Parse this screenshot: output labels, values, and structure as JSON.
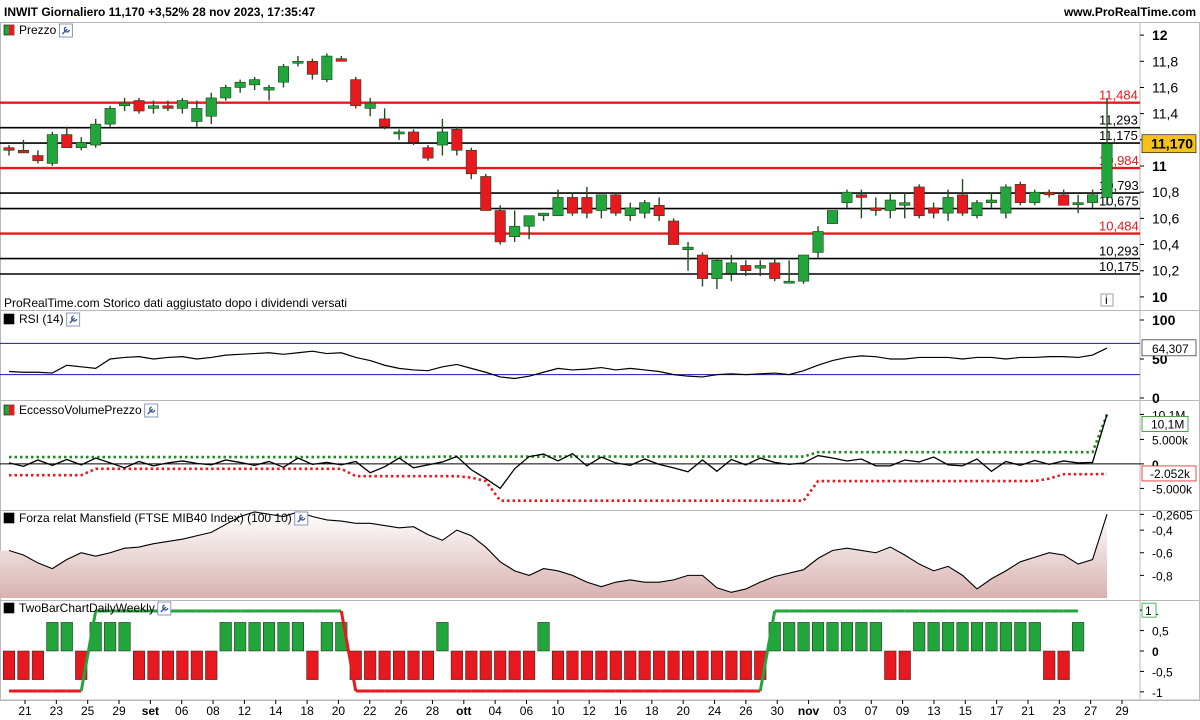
{
  "header": {
    "title": "INWIT Giornaliero 11,170 +3,52% 28 nov 2023, 17:35:47",
    "site": "www.ProRealTime.com"
  },
  "colors": {
    "up": "#22a63c",
    "down": "#e8191e",
    "wick": "#1f4f1f",
    "support_resistance": "#e8191e",
    "level": "#000000",
    "last_price_bg": "#f3c21b",
    "rsi": "#000000",
    "rsi_bands": "#1a1aa6",
    "evp_up_band": "#1e8c1e",
    "evp_down_band": "#e8191e",
    "mansfield_fill": "#d9b1b1",
    "twobar_up": "#22a63c",
    "twobar_down": "#e8191e"
  },
  "panels": {
    "price": {
      "title": "Prezzo",
      "icon": "wrench-icon",
      "note": "ProRealTime.com Storico dati aggiustato dopo i dividendi versati",
      "info_icon": "i"
    },
    "rsi": {
      "title": "RSI (14)",
      "icon": "wrench-icon"
    },
    "evp": {
      "title": "EccessoVolumePrezzo",
      "icon": "wrench-icon"
    },
    "mansfield": {
      "title": "Forza relat Mansfield (FTSE MIB40 Index) (100 10)",
      "icon": "wrench-icon"
    },
    "twobar": {
      "title": "TwoBarChartDailyWeekly",
      "icon": "wrench-icon"
    }
  },
  "chart_data": [
    {
      "type": "candlestick",
      "name": "Prezzo",
      "ylim": [
        9.9,
        12.1
      ],
      "y_ticks": [
        "12",
        "11,8",
        "11,6",
        "11,4",
        "11,2",
        "11",
        "10,8",
        "10,6",
        "10,4",
        "10,2",
        "10"
      ],
      "y_tick_values": [
        12,
        11.8,
        11.6,
        11.4,
        11.2,
        11,
        10.8,
        10.6,
        10.4,
        10.2,
        10
      ],
      "x_labels": [
        "21",
        "23",
        "25",
        "29",
        "set",
        "06",
        "08",
        "12",
        "14",
        "18",
        "20",
        "22",
        "26",
        "28",
        "ott",
        "04",
        "06",
        "10",
        "12",
        "16",
        "18",
        "20",
        "24",
        "26",
        "30",
        "nov",
        "03",
        "07",
        "09",
        "13",
        "15",
        "17",
        "21",
        "23",
        "27",
        "29"
      ],
      "x_label_months": [
        "set",
        "ott",
        "nov"
      ],
      "last_price": "11,170",
      "levels": [
        {
          "value": 11.484,
          "label": "11,484",
          "kind": "support_resistance"
        },
        {
          "value": 11.293,
          "label": "11,293",
          "kind": "level"
        },
        {
          "value": 11.175,
          "label": "11,175",
          "kind": "level"
        },
        {
          "value": 10.984,
          "label": "10,984",
          "kind": "support_resistance"
        },
        {
          "value": 10.793,
          "label": "10,793",
          "kind": "level"
        },
        {
          "value": 10.675,
          "label": "10,675",
          "kind": "level"
        },
        {
          "value": 10.484,
          "label": "10,484",
          "kind": "support_resistance"
        },
        {
          "value": 10.293,
          "label": "10,293",
          "kind": "level"
        },
        {
          "value": 10.175,
          "label": "10,175",
          "kind": "level"
        }
      ],
      "candles": [
        [
          11.14,
          11.16,
          11.08,
          11.12
        ],
        [
          11.12,
          11.2,
          11.1,
          11.1
        ],
        [
          11.08,
          11.12,
          11.02,
          11.04
        ],
        [
          11.02,
          11.26,
          11.0,
          11.24
        ],
        [
          11.24,
          11.3,
          11.16,
          11.14
        ],
        [
          11.14,
          11.22,
          11.12,
          11.18
        ],
        [
          11.16,
          11.36,
          11.14,
          11.32
        ],
        [
          11.32,
          11.46,
          11.3,
          11.44
        ],
        [
          11.46,
          11.52,
          11.42,
          11.48
        ],
        [
          11.5,
          11.52,
          11.4,
          11.42
        ],
        [
          11.44,
          11.5,
          11.4,
          11.46
        ],
        [
          11.46,
          11.5,
          11.42,
          11.44
        ],
        [
          11.44,
          11.52,
          11.4,
          11.5
        ],
        [
          11.34,
          11.5,
          11.3,
          11.44
        ],
        [
          11.38,
          11.56,
          11.32,
          11.52
        ],
        [
          11.52,
          11.62,
          11.5,
          11.6
        ],
        [
          11.6,
          11.66,
          11.56,
          11.64
        ],
        [
          11.62,
          11.68,
          11.58,
          11.66
        ],
        [
          11.58,
          11.62,
          11.5,
          11.6
        ],
        [
          11.64,
          11.78,
          11.6,
          11.76
        ],
        [
          11.8,
          11.84,
          11.76,
          11.8
        ],
        [
          11.8,
          11.82,
          11.66,
          11.7
        ],
        [
          11.66,
          11.86,
          11.64,
          11.84
        ],
        [
          11.82,
          11.84,
          11.8,
          11.8
        ],
        [
          11.66,
          11.68,
          11.44,
          11.46
        ],
        [
          11.44,
          11.52,
          11.38,
          11.48
        ],
        [
          11.36,
          11.44,
          11.28,
          11.3
        ],
        [
          11.26,
          11.28,
          11.2,
          11.26
        ],
        [
          11.26,
          11.28,
          11.16,
          11.18
        ],
        [
          11.14,
          11.16,
          11.04,
          11.06
        ],
        [
          11.16,
          11.36,
          11.08,
          11.26
        ],
        [
          11.28,
          11.3,
          11.08,
          11.12
        ],
        [
          11.12,
          11.14,
          10.9,
          10.94
        ],
        [
          10.92,
          10.94,
          10.66,
          10.66
        ],
        [
          10.66,
          10.7,
          10.4,
          10.42
        ],
        [
          10.46,
          10.66,
          10.42,
          10.54
        ],
        [
          10.54,
          10.56,
          10.44,
          10.62
        ],
        [
          10.62,
          10.64,
          10.58,
          10.64
        ],
        [
          10.62,
          10.82,
          10.62,
          10.76
        ],
        [
          10.76,
          10.8,
          10.62,
          10.64
        ],
        [
          10.76,
          10.84,
          10.6,
          10.64
        ],
        [
          10.66,
          10.74,
          10.6,
          10.78
        ],
        [
          10.78,
          10.8,
          10.62,
          10.64
        ],
        [
          10.62,
          10.72,
          10.58,
          10.68
        ],
        [
          10.64,
          10.74,
          10.6,
          10.72
        ],
        [
          10.7,
          10.76,
          10.58,
          10.62
        ],
        [
          10.58,
          10.6,
          10.4,
          10.4
        ],
        [
          10.36,
          10.42,
          10.2,
          10.38
        ],
        [
          10.32,
          10.34,
          10.08,
          10.14
        ],
        [
          10.14,
          10.3,
          10.06,
          10.28
        ],
        [
          10.18,
          10.32,
          10.12,
          10.26
        ],
        [
          10.24,
          10.28,
          10.16,
          10.2
        ],
        [
          10.22,
          10.28,
          10.16,
          10.24
        ],
        [
          10.26,
          10.3,
          10.12,
          10.14
        ],
        [
          10.12,
          10.28,
          10.12,
          10.12
        ],
        [
          10.12,
          10.3,
          10.1,
          10.32
        ],
        [
          10.34,
          10.54,
          10.3,
          10.5
        ],
        [
          10.56,
          10.64,
          10.6,
          10.66
        ],
        [
          10.72,
          10.82,
          10.68,
          10.8
        ],
        [
          10.78,
          10.82,
          10.6,
          10.76
        ],
        [
          10.68,
          10.76,
          10.62,
          10.66
        ],
        [
          10.66,
          10.8,
          10.6,
          10.74
        ],
        [
          10.7,
          10.8,
          10.6,
          10.72
        ],
        [
          10.84,
          10.86,
          10.6,
          10.62
        ],
        [
          10.68,
          10.72,
          10.6,
          10.64
        ],
        [
          10.64,
          10.82,
          10.58,
          10.76
        ],
        [
          10.78,
          10.9,
          10.62,
          10.64
        ],
        [
          10.62,
          10.74,
          10.6,
          10.72
        ],
        [
          10.72,
          10.8,
          10.68,
          10.74
        ],
        [
          10.64,
          10.86,
          10.6,
          10.84
        ],
        [
          10.86,
          10.88,
          10.7,
          10.72
        ],
        [
          10.72,
          10.82,
          10.7,
          10.8
        ],
        [
          10.8,
          10.82,
          10.76,
          10.78
        ],
        [
          10.78,
          10.82,
          10.74,
          10.7
        ],
        [
          10.72,
          10.78,
          10.64,
          10.72
        ],
        [
          10.72,
          10.82,
          10.68,
          10.78
        ],
        [
          10.76,
          11.52,
          10.7,
          11.17
        ]
      ],
      "candles_format": [
        "open",
        "high",
        "low",
        "close"
      ]
    },
    {
      "type": "line",
      "name": "RSI (14)",
      "ylim": [
        0,
        100
      ],
      "y_ticks": [
        "100",
        "50",
        "0"
      ],
      "y_tick_values": [
        100,
        50,
        0
      ],
      "bands": [
        70,
        30
      ],
      "last_value": "64,307",
      "values": [
        34,
        33,
        33,
        32,
        42,
        40,
        38,
        50,
        52,
        53,
        50,
        52,
        53,
        50,
        52,
        55,
        56,
        57,
        58,
        56,
        58,
        60,
        57,
        58,
        52,
        48,
        42,
        38,
        36,
        35,
        40,
        43,
        38,
        33,
        27,
        25,
        28,
        33,
        38,
        36,
        37,
        39,
        36,
        38,
        36,
        34,
        30,
        28,
        27,
        30,
        31,
        30,
        31,
        32,
        30,
        35,
        42,
        48,
        52,
        54,
        53,
        50,
        50,
        52,
        52,
        52,
        50,
        52,
        52,
        50,
        52,
        52,
        53,
        53,
        52,
        55,
        64
      ]
    },
    {
      "type": "line",
      "name": "EccessoVolumePrezzo",
      "ylim": [
        -9000,
        11000
      ],
      "y_ticks": [
        "10,1M",
        "5.000k",
        "0",
        "-5.000k"
      ],
      "y_tick_values": [
        10100,
        5000,
        0,
        -5000
      ],
      "last_values": [
        "10,1M",
        "-2.052k"
      ],
      "values": [
        200,
        -500,
        800,
        -300,
        900,
        -200,
        1200,
        200,
        -800,
        500,
        -400,
        200,
        600,
        100,
        -200,
        800,
        300,
        -300,
        500,
        -700,
        1200,
        -100,
        300,
        -200,
        500,
        -1800,
        -600,
        1200,
        -800,
        -200,
        400,
        1500,
        -1200,
        -3000,
        -5000,
        -1000,
        1500,
        2000,
        600,
        2100,
        -400,
        1400,
        200,
        -300,
        1000,
        -100,
        -800,
        -1600,
        800,
        -1500,
        900,
        -200,
        1200,
        300,
        -100,
        200,
        1700,
        1200,
        600,
        1000,
        -400,
        -400,
        800,
        400,
        1400,
        -200,
        -400,
        1000,
        -1500,
        500,
        -300,
        700,
        -100,
        600,
        200,
        300,
        10100
      ],
      "upper_band": [
        1400,
        1400,
        1400,
        1400,
        1400,
        1400,
        1400,
        1400,
        1400,
        1400,
        1400,
        1400,
        1400,
        1400,
        1400,
        1400,
        1400,
        1400,
        1400,
        1400,
        1400,
        1400,
        1400,
        1400,
        1400,
        1400,
        1400,
        1400,
        1400,
        1400,
        1500,
        1500,
        1500,
        1500,
        1500,
        1500,
        1500,
        1500,
        1500,
        1500,
        1500,
        1500,
        1500,
        1500,
        1500,
        1500,
        1500,
        1500,
        1500,
        1500,
        1500,
        1500,
        1500,
        1500,
        1500,
        1500,
        2400,
        2400,
        2400,
        2400,
        2400,
        2400,
        2400,
        2400,
        2400,
        2400,
        2400,
        2400,
        2400,
        2400,
        2400,
        2400,
        2400,
        2400,
        2400,
        2400,
        10100
      ],
      "lower_band": [
        -2300,
        -2300,
        -2300,
        -2300,
        -2300,
        -2300,
        -1000,
        -1000,
        -1000,
        -1000,
        -1000,
        -1000,
        -1000,
        -1000,
        -1000,
        -1000,
        -1000,
        -1000,
        -1000,
        -1000,
        -1000,
        -1000,
        -1000,
        -1000,
        -2500,
        -2500,
        -2500,
        -2500,
        -2500,
        -2500,
        -2500,
        -2500,
        -2800,
        -3500,
        -7500,
        -7500,
        -7500,
        -7500,
        -7500,
        -7500,
        -7500,
        -7500,
        -7500,
        -7500,
        -7500,
        -7500,
        -7500,
        -7500,
        -7500,
        -7500,
        -7500,
        -7500,
        -7500,
        -7500,
        -7500,
        -7500,
        -3500,
        -3500,
        -3500,
        -3500,
        -3500,
        -3500,
        -3500,
        -3500,
        -3500,
        -3500,
        -3500,
        -3500,
        -3500,
        -3500,
        -3500,
        -3500,
        -3000,
        -2100,
        -2100,
        -2100,
        -2052
      ]
    },
    {
      "type": "area",
      "name": "Forza relat Mansfield (FTSE MIB40 Index) (100 10)",
      "ylim": [
        -1.0,
        -0.24
      ],
      "y_ticks": [
        "-0,2605",
        "-0,4",
        "-0,6",
        "-0,8"
      ],
      "y_tick_values": [
        -0.2605,
        -0.4,
        -0.6,
        -0.8
      ],
      "values": [
        -0.58,
        -0.62,
        -0.69,
        -0.74,
        -0.66,
        -0.6,
        -0.63,
        -0.6,
        -0.56,
        -0.55,
        -0.52,
        -0.5,
        -0.48,
        -0.45,
        -0.42,
        -0.35,
        -0.28,
        -0.24,
        -0.26,
        -0.28,
        -0.24,
        -0.28,
        -0.31,
        -0.32,
        -0.34,
        -0.34,
        -0.36,
        -0.38,
        -0.37,
        -0.44,
        -0.49,
        -0.4,
        -0.45,
        -0.55,
        -0.68,
        -0.76,
        -0.8,
        -0.74,
        -0.76,
        -0.8,
        -0.86,
        -0.9,
        -0.86,
        -0.84,
        -0.86,
        -0.86,
        -0.84,
        -0.8,
        -0.8,
        -0.91,
        -0.95,
        -0.92,
        -0.86,
        -0.81,
        -0.78,
        -0.75,
        -0.65,
        -0.58,
        -0.56,
        -0.58,
        -0.6,
        -0.55,
        -0.62,
        -0.7,
        -0.76,
        -0.72,
        -0.8,
        -0.92,
        -0.83,
        -0.76,
        -0.68,
        -0.64,
        -0.6,
        -0.62,
        -0.7,
        -0.66,
        -0.2605
      ]
    },
    {
      "type": "bar",
      "name": "TwoBarChartDailyWeekly",
      "ylim": [
        -1.2,
        1.2
      ],
      "y_ticks": [
        "1",
        "0,5",
        "0",
        "-0,5",
        "-1"
      ],
      "y_tick_values": [
        1,
        0.5,
        0,
        -0.5,
        -1
      ],
      "last_value": "1",
      "values": [
        -1,
        -1,
        -1,
        1,
        1,
        -1,
        1,
        1,
        1,
        -1,
        -1,
        -1,
        -1,
        -1,
        -1,
        1,
        1,
        1,
        1,
        1,
        1,
        -1,
        1,
        1,
        -1,
        -1,
        -1,
        -1,
        -1,
        -1,
        1,
        -1,
        -1,
        -1,
        -1,
        -1,
        -1,
        1,
        -1,
        -1,
        -1,
        -1,
        -1,
        -1,
        -1,
        -1,
        -1,
        -1,
        -1,
        -1,
        -1,
        -1,
        -1,
        1,
        1,
        1,
        1,
        1,
        1,
        1,
        1,
        -1,
        -1,
        1,
        1,
        1,
        1,
        1,
        1,
        1,
        1,
        1,
        -1,
        -1,
        1
      ],
      "weekly_line": [
        -1,
        -1,
        -1,
        -1,
        -1,
        -1,
        1,
        1,
        1,
        1,
        1,
        1,
        1,
        1,
        1,
        1,
        1,
        1,
        1,
        1,
        1,
        1,
        1,
        1,
        -1,
        -1,
        -1,
        -1,
        -1,
        -1,
        -1,
        -1,
        -1,
        -1,
        -1,
        -1,
        -1,
        -1,
        -1,
        -1,
        -1,
        -1,
        -1,
        -1,
        -1,
        -1,
        -1,
        -1,
        -1,
        -1,
        -1,
        -1,
        -1,
        1,
        1,
        1,
        1,
        1,
        1,
        1,
        1,
        1,
        1,
        1,
        1,
        1,
        1,
        1,
        1,
        1,
        1,
        1,
        1,
        1,
        1
      ]
    }
  ]
}
